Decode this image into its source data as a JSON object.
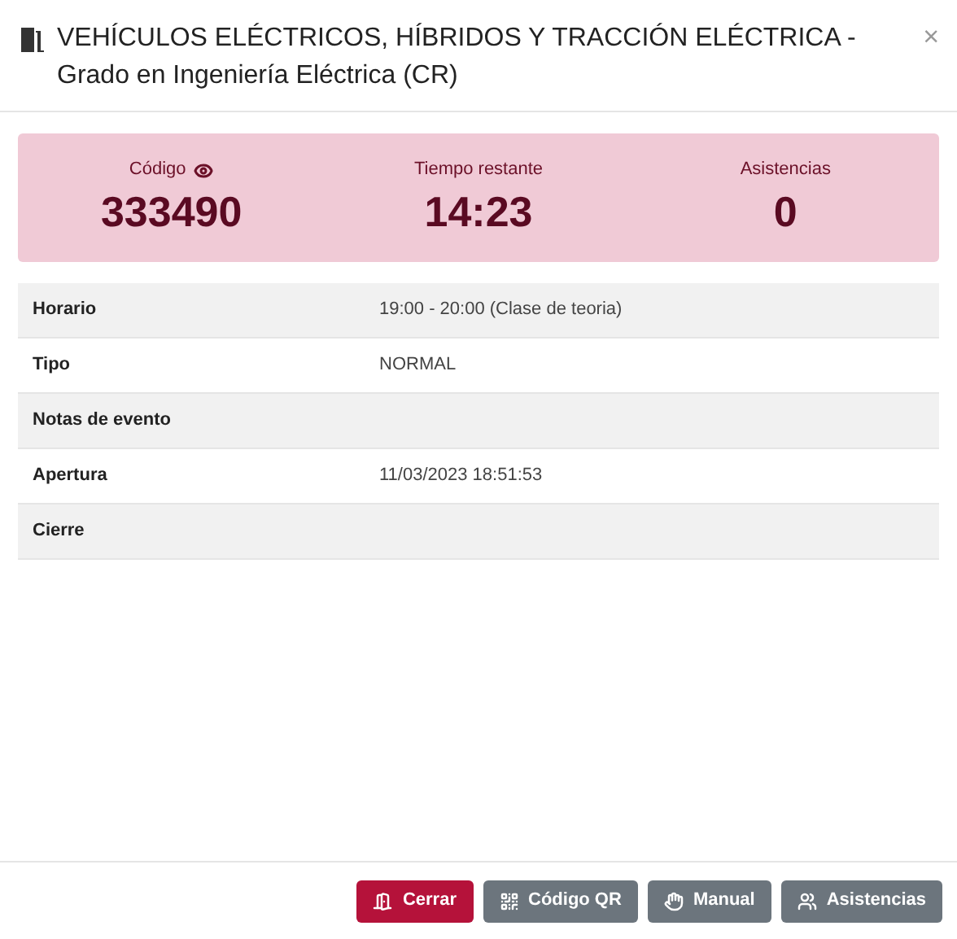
{
  "dialog": {
    "title": "VEHÍCULOS ELÉCTRICOS, HÍBRIDOS Y TRACCIÓN ELÉCTRICA - Grado en Ingeniería Eléctrica (CR)",
    "close": "×"
  },
  "stats": [
    {
      "label": "Código",
      "value": "333490",
      "kind": "eye"
    },
    {
      "label": "Tiempo restante",
      "value": "14:23",
      "kind": "plain"
    },
    {
      "label": "Asistencias",
      "value": "0",
      "kind": "plain"
    }
  ],
  "details": [
    {
      "label": "Horario",
      "value": "19:00 - 20:00 (Clase de teoria)"
    },
    {
      "label": "Tipo",
      "value": "NORMAL"
    },
    {
      "label": "Notas de evento"
    },
    {
      "label": "Apertura",
      "value": "11/03/2023 18:51:53"
    },
    {
      "label": "Cierre"
    }
  ],
  "buttons": [
    {
      "label": "Cerrar",
      "kind": "danger"
    },
    {
      "label": "Código QR",
      "kind": "secondary"
    },
    {
      "label": "Manual",
      "kind": "secondary"
    },
    {
      "label": "Asistencias",
      "kind": "secondary"
    }
  ]
}
